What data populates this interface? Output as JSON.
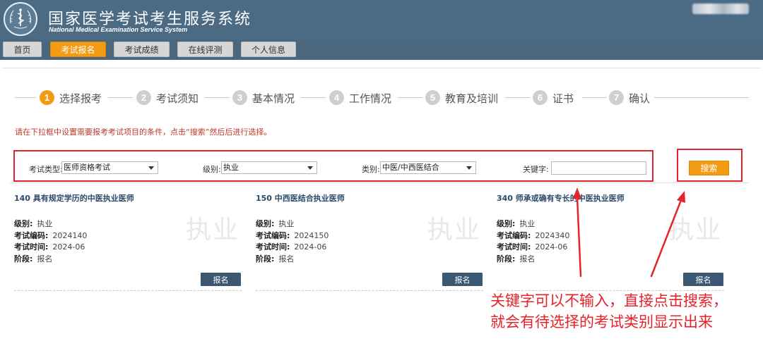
{
  "header": {
    "title_cn": "国家医学考试考生服务系统",
    "title_en": "National Medical Examination Service System",
    "logo_icon": "caduceus-emblem-icon",
    "bg_color": "#4b6a84"
  },
  "nav": {
    "items": [
      "首页",
      "考试报名",
      "考试成绩",
      "在线评测",
      "个人信息"
    ],
    "active_index": 1,
    "active_color": "#f29b15"
  },
  "steps": {
    "items": [
      {
        "num": "1",
        "label": "选择报考"
      },
      {
        "num": "2",
        "label": "考试须知"
      },
      {
        "num": "3",
        "label": "基本情况"
      },
      {
        "num": "4",
        "label": "工作情况"
      },
      {
        "num": "5",
        "label": "教育及培训"
      },
      {
        "num": "6",
        "label": "证书"
      },
      {
        "num": "7",
        "label": "确认"
      }
    ],
    "active_index": 0
  },
  "instruction": "请在下拉框中设置需要报考考试项目的条件，点击“搜索”然后后进行选择。",
  "filters": {
    "exam_type_label": "考试类型:",
    "exam_type_value": "医师资格考试",
    "level_label": "级别:",
    "level_value": "执业",
    "category_label": "类别:",
    "category_value": "中医/中西医结合",
    "keyword_label": "关键字:",
    "keyword_value": "",
    "search_label": "搜索"
  },
  "cards": [
    {
      "title": "140 具有规定学历的中医执业医师",
      "watermark": "执业",
      "level_label": "级别:",
      "level": "执业",
      "code_label": "考试编码:",
      "code": "2024140",
      "time_label": "考试时间:",
      "time": "2024-06",
      "stage_label": "阶段:",
      "stage": "报名",
      "button": "报名"
    },
    {
      "title": "150 中西医结合执业医师",
      "watermark": "执业",
      "level_label": "级别:",
      "level": "执业",
      "code_label": "考试编码:",
      "code": "2024150",
      "time_label": "考试时间:",
      "time": "2024-06",
      "stage_label": "阶段:",
      "stage": "报名",
      "button": "报名"
    },
    {
      "title": "340 师承或确有专长的中医执业医师",
      "watermark": "执业",
      "level_label": "级别:",
      "level": "执业",
      "code_label": "考试编码:",
      "code": "2024340",
      "time_label": "考试时间:",
      "time": "2024-06",
      "stage_label": "阶段:",
      "stage": "报名",
      "button": "报名"
    }
  ],
  "annotation": {
    "line1": "关键字可以不输入，直接点击搜索，",
    "line2": "就会有待选择的考试类别显示出来",
    "color": "#e6232a"
  }
}
